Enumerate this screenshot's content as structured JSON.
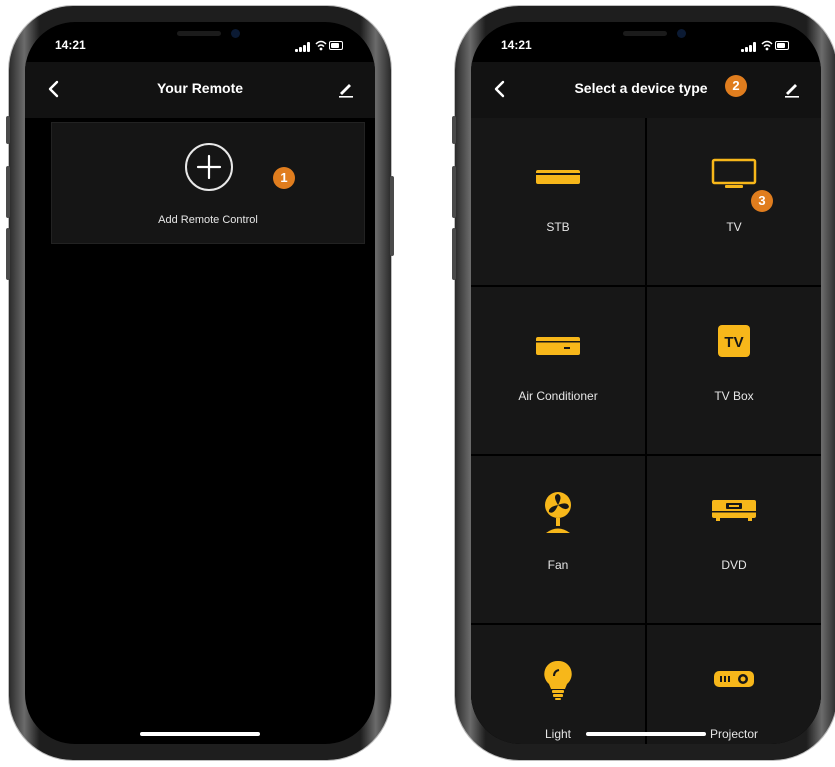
{
  "colors": {
    "accent": "#F7B71A",
    "badge": "#E07D1E",
    "background": "#000000",
    "surface": "#171717"
  },
  "left_phone": {
    "status_time": "14:21",
    "header": {
      "title": "Your Remote",
      "back_icon": "chevron-left-icon",
      "edit_icon": "pencil-icon"
    },
    "add_card": {
      "label": "Add Remote Control",
      "icon": "plus-circle-icon"
    },
    "badge": "1"
  },
  "right_phone": {
    "status_time": "14:21",
    "header": {
      "title": "Select a device type",
      "back_icon": "chevron-left-icon",
      "edit_icon": "pencil-icon"
    },
    "title_badge": "2",
    "tv_badge": "3",
    "device_types": [
      {
        "label": "STB",
        "icon": "stb-icon"
      },
      {
        "label": "TV",
        "icon": "tv-icon"
      },
      {
        "label": "Air Conditioner",
        "icon": "air-conditioner-icon"
      },
      {
        "label": "TV Box",
        "icon": "tv-box-icon",
        "icon_text": "TV"
      },
      {
        "label": "Fan",
        "icon": "fan-icon"
      },
      {
        "label": "DVD",
        "icon": "dvd-icon"
      },
      {
        "label": "Light",
        "icon": "light-bulb-icon"
      },
      {
        "label": "Projector",
        "icon": "projector-icon"
      }
    ]
  }
}
